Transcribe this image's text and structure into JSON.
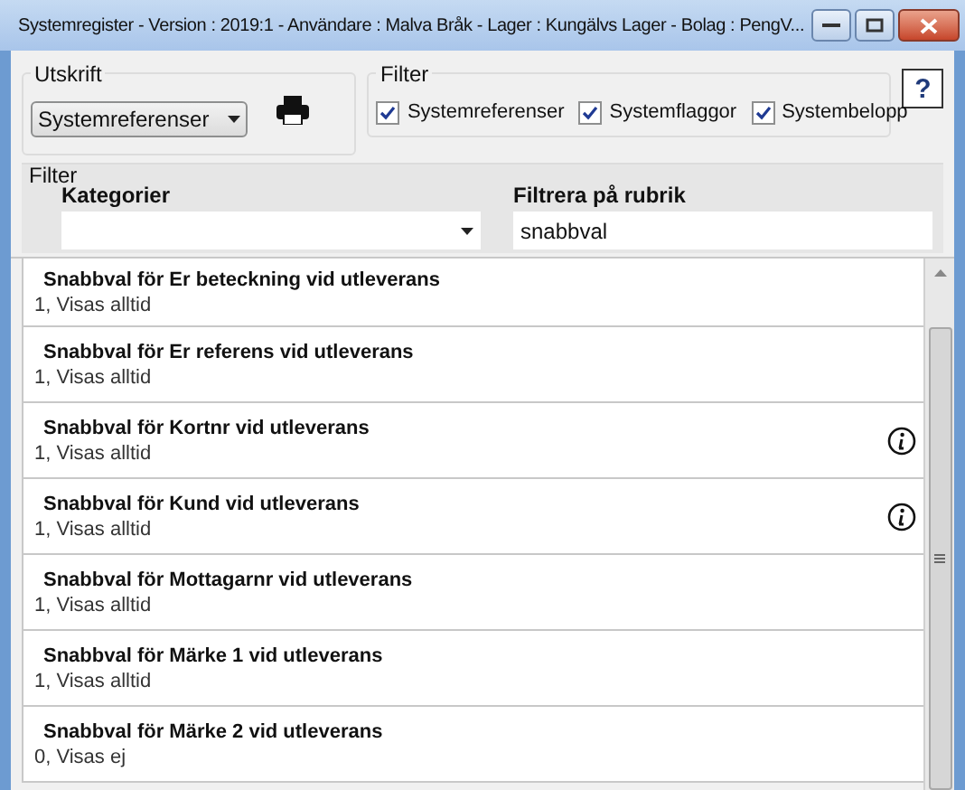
{
  "window": {
    "title": "Systemregister - Version : 2019:1 - Användare : Malva Bråk - Lager : Kungälvs Lager  - Bolag : PengV..."
  },
  "print_group": {
    "label": "Utskrift",
    "select_value": "Systemreferenser"
  },
  "filter_group": {
    "label": "Filter",
    "checkboxes": [
      {
        "label": "Systemreferenser",
        "checked": true
      },
      {
        "label": "Systemflaggor",
        "checked": true
      },
      {
        "label": "Systembelopp",
        "checked": true
      }
    ]
  },
  "help_button": "?",
  "filter_panel": {
    "label": "Filter",
    "category_label": "Kategorier",
    "heading_filter_label": "Filtrera på rubrik",
    "heading_filter_value": "snabbval"
  },
  "rows": [
    {
      "title": "Snabbval för Er beteckning vid utleverans",
      "value": "1, Visas alltid",
      "info": false
    },
    {
      "title": "Snabbval för Er referens vid utleverans",
      "value": "1, Visas alltid",
      "info": false
    },
    {
      "title": "Snabbval för Kortnr vid utleverans",
      "value": "1, Visas alltid",
      "info": true
    },
    {
      "title": "Snabbval för Kund vid utleverans",
      "value": "1, Visas alltid",
      "info": true
    },
    {
      "title": "Snabbval för Mottagarnr vid utleverans",
      "value": "1, Visas alltid",
      "info": false
    },
    {
      "title": "Snabbval för Märke 1 vid utleverans",
      "value": "1, Visas alltid",
      "info": false
    },
    {
      "title": "Snabbval för Märke 2 vid utleverans",
      "value": "0, Visas ej",
      "info": false
    }
  ]
}
